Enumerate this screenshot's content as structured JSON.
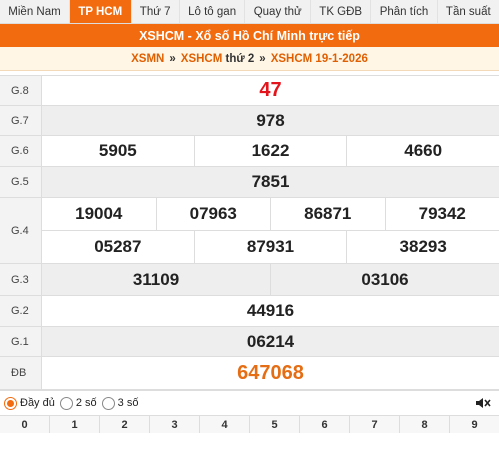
{
  "tabs": [
    "Miền Nam",
    "TP HCM",
    "Thứ 7",
    "Lô tô gan",
    "Quay thử",
    "TK GĐB",
    "Phân tích",
    "Tần suất"
  ],
  "header": "XSHCM - Xổ số Hồ Chí Minh trực tiếp",
  "breadcrumb": {
    "a": "XSMN",
    "sep": "»",
    "b": "XSHCM",
    "c": "thứ 2",
    "d": "XSHCM 19-1-2026"
  },
  "prizes": {
    "g8": {
      "label": "G.8",
      "values": [
        "47"
      ]
    },
    "g7": {
      "label": "G.7",
      "values": [
        "978"
      ]
    },
    "g6": {
      "label": "G.6",
      "values": [
        "5905",
        "1622",
        "4660"
      ]
    },
    "g5": {
      "label": "G.5",
      "values": [
        "7851"
      ]
    },
    "g4": {
      "label": "G.4",
      "row1": [
        "19004",
        "07963",
        "86871",
        "79342"
      ],
      "row2": [
        "05287",
        "87931",
        "38293"
      ]
    },
    "g3": {
      "label": "G.3",
      "values": [
        "31109",
        "03106"
      ]
    },
    "g2": {
      "label": "G.2",
      "values": [
        "44916"
      ]
    },
    "g1": {
      "label": "G.1",
      "values": [
        "06214"
      ]
    },
    "db": {
      "label": "ĐB",
      "values": [
        "647068"
      ]
    }
  },
  "options": [
    "Đầy đủ",
    "2 số",
    "3 số"
  ],
  "digits": [
    "0",
    "1",
    "2",
    "3",
    "4",
    "5",
    "6",
    "7",
    "8",
    "9"
  ],
  "colors": {
    "accent": "#f26b0f",
    "special": "#e56d14",
    "g8": "#e3141b"
  }
}
